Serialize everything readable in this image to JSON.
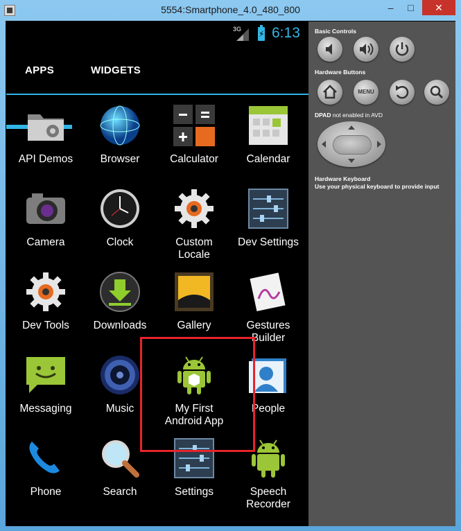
{
  "window": {
    "title": "5554:Smartphone_4.0_480_800",
    "minimize": "–",
    "maximize": "□",
    "close": "✕"
  },
  "statusbar": {
    "network": "3G",
    "time": "6:13"
  },
  "tabs": [
    {
      "label": "APPS",
      "selected": true
    },
    {
      "label": "WIDGETS",
      "selected": false
    }
  ],
  "apps": [
    {
      "label": "API Demos",
      "icon": "folder-gear-icon"
    },
    {
      "label": "Browser",
      "icon": "globe-icon"
    },
    {
      "label": "Calculator",
      "icon": "calculator-icon"
    },
    {
      "label": "Calendar",
      "icon": "calendar-icon"
    },
    {
      "label": "Camera",
      "icon": "camera-icon"
    },
    {
      "label": "Clock",
      "icon": "clock-icon"
    },
    {
      "label": "Custom\nLocale",
      "icon": "gear-icon"
    },
    {
      "label": "Dev Settings",
      "icon": "sliders-icon"
    },
    {
      "label": "Dev Tools",
      "icon": "gear-icon"
    },
    {
      "label": "Downloads",
      "icon": "download-icon"
    },
    {
      "label": "Gallery",
      "icon": "gallery-icon"
    },
    {
      "label": "Gestures\nBuilder",
      "icon": "gestures-icon"
    },
    {
      "label": "Messaging",
      "icon": "messaging-icon"
    },
    {
      "label": "Music",
      "icon": "speaker-icon"
    },
    {
      "label": "My First\nAndroid App",
      "icon": "android-icon"
    },
    {
      "label": "People",
      "icon": "people-icon"
    },
    {
      "label": "Phone",
      "icon": "phone-icon"
    },
    {
      "label": "Search",
      "icon": "magnifier-icon"
    },
    {
      "label": "Settings",
      "icon": "sliders-icon"
    },
    {
      "label": "Speech\nRecorder",
      "icon": "android-icon"
    }
  ],
  "panel": {
    "basic_controls": "Basic Controls",
    "hardware_buttons": "Hardware Buttons",
    "dpad_title": "DPAD",
    "dpad_note": "not enabled in AVD",
    "keyboard_title": "Hardware Keyboard",
    "keyboard_note": "Use your physical keyboard to provide input",
    "menu_label": "MENU"
  },
  "colors": {
    "accent": "#33b5e5",
    "highlight": "#e8232a",
    "close_button": "#c7322b"
  }
}
